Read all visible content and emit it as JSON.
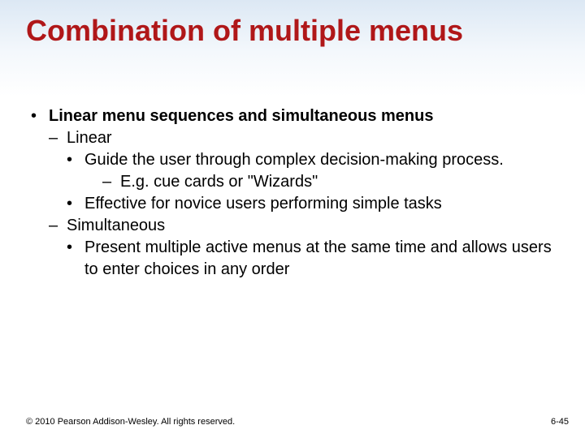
{
  "title": "Combination of multiple menus",
  "bullets": {
    "b1": "Linear menu sequences and simultaneous menus",
    "b1_1": "Linear",
    "b1_1_1": "Guide the user through complex decision-making process.",
    "b1_1_1_1": "E.g. cue cards or \"Wizards\"",
    "b1_1_2": "Effective for novice users performing simple tasks",
    "b1_2": "Simultaneous",
    "b1_2_1": "Present multiple active menus at the same time and allows users to enter choices in any order"
  },
  "footer": {
    "copyright": "© 2010 Pearson Addison-Wesley. All rights reserved.",
    "page": "6-45"
  }
}
